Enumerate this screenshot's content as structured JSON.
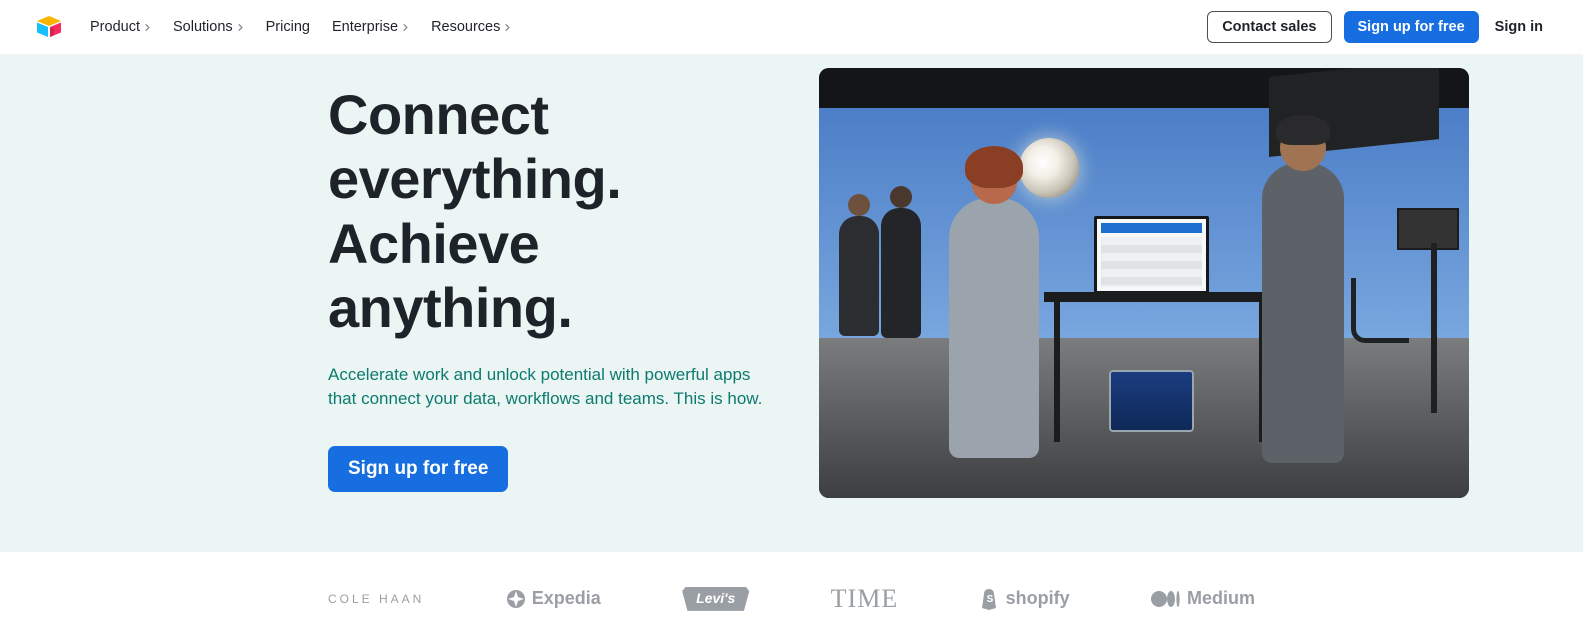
{
  "nav": {
    "items": [
      {
        "label": "Product",
        "has_menu": true
      },
      {
        "label": "Solutions",
        "has_menu": true
      },
      {
        "label": "Pricing",
        "has_menu": false
      },
      {
        "label": "Enterprise",
        "has_menu": true
      },
      {
        "label": "Resources",
        "has_menu": true
      }
    ],
    "contact_sales": "Contact sales",
    "signup": "Sign up for free",
    "signin": "Sign in"
  },
  "hero": {
    "title_line1": "Connect everything.",
    "title_line2": "Achieve anything.",
    "subtitle": "Accelerate work and unlock potential with powerful apps that connect your data, workflows and teams. This is how.",
    "cta": "Sign up for free",
    "image_alt": "Film production studio with two people reviewing an app on a tablet and monitor"
  },
  "brands": [
    "COLE HAAN",
    "Expedia",
    "Levi's",
    "TIME",
    "shopify",
    "Medium"
  ],
  "colors": {
    "primary_blue": "#166ee1",
    "hero_bg": "#ebf5f4",
    "teal_text": "#0d7a6f"
  }
}
